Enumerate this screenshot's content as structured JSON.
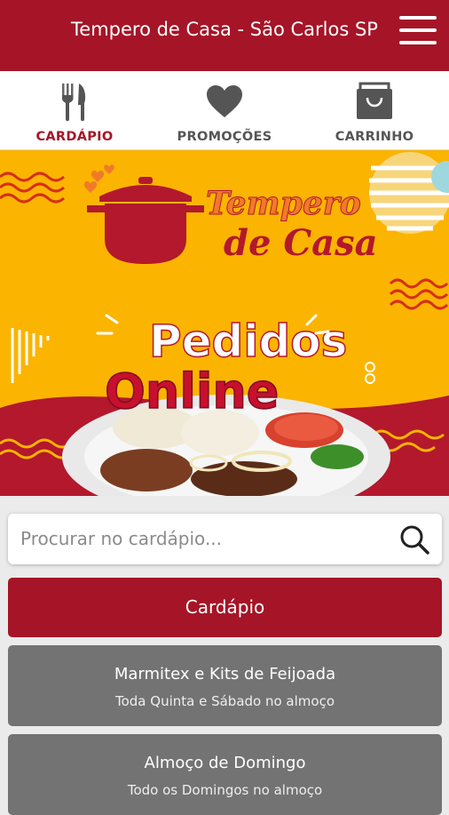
{
  "header": {
    "title": "Tempero de Casa - São Carlos SP"
  },
  "tabs": [
    {
      "label": "CARDÁPIO",
      "icon": "utensils-icon",
      "active": true
    },
    {
      "label": "PROMOÇÕES",
      "icon": "heart-icon",
      "active": false
    },
    {
      "label": "CARRINHO",
      "icon": "shopping-bag-icon",
      "active": false
    }
  ],
  "banner": {
    "logo_line1": "Tempero",
    "logo_line2": "de Casa",
    "headline1": "Pedidos",
    "headline2": "Online"
  },
  "search": {
    "placeholder": "Procurar no cardápio..."
  },
  "menu_button": {
    "label": "Cardápio"
  },
  "categories": [
    {
      "name": "Marmitex e Kits de Feijoada",
      "description": "Toda Quinta e Sábado no almoço"
    },
    {
      "name": "Almoço de Domingo",
      "description": "Todo os Domingos no almoço"
    }
  ],
  "colors": {
    "brand": "#a51527",
    "banner_bg": "#fbb400",
    "category_bg": "#737373"
  }
}
